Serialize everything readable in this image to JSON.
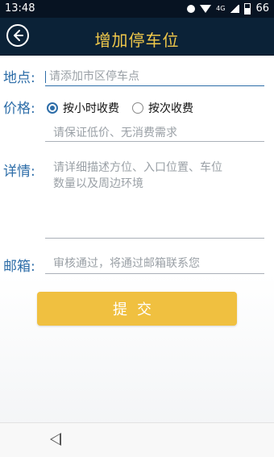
{
  "status": {
    "time": "13:48",
    "network": "4G",
    "battery": "66"
  },
  "header": {
    "title": "增加停车位"
  },
  "form": {
    "location_label": "地点:",
    "location_placeholder": "请添加市区停车点",
    "price_label": "价格:",
    "price_options": [
      "按小时收费",
      "按次收费"
    ],
    "price_selected": "按小时收费",
    "price_placeholder": "请保证低价、无消费需求",
    "details_label": "详情:",
    "details_placeholder_line1": "请详细描述方位、入口位置、车位",
    "details_placeholder_line2": "数量以及周边环境",
    "email_label": "邮箱:",
    "email_placeholder": "审核通过，将通过邮箱联系您",
    "submit_label": "提交"
  }
}
